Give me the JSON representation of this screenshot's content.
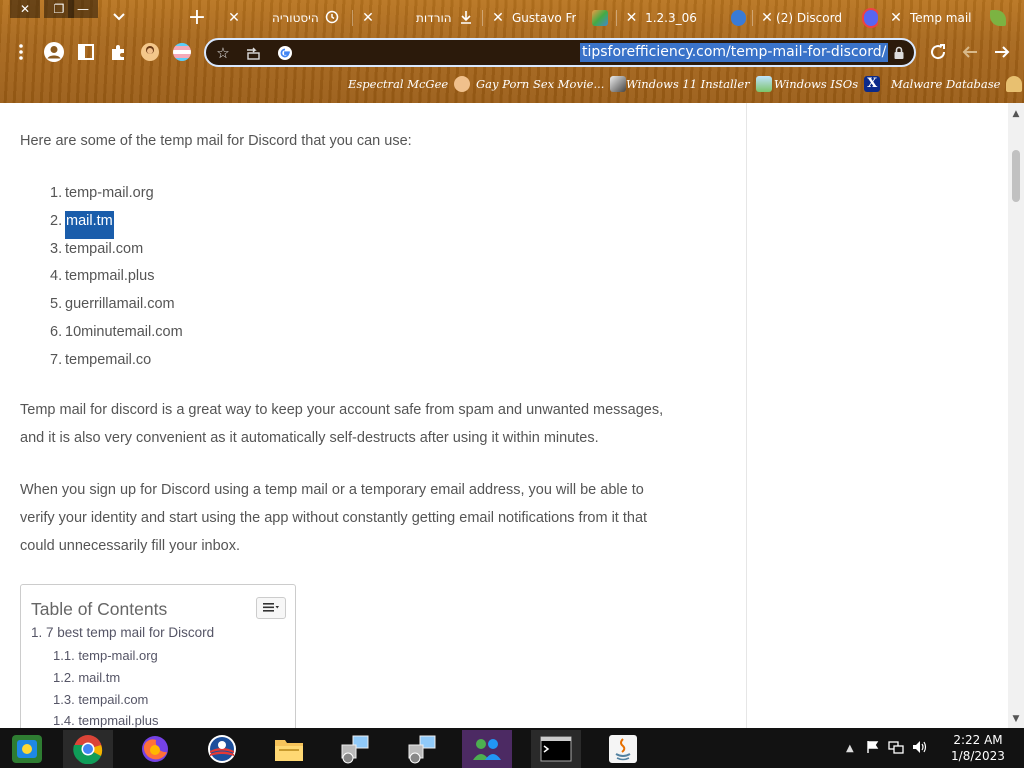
{
  "window_controls": {
    "close": "✕",
    "restore": "❐",
    "minimize": "—"
  },
  "tabs": [
    {
      "title": "",
      "icon": "chevron-down-icon"
    },
    {
      "title": "היסטוריה",
      "icon": "history-icon"
    },
    {
      "title": "הורדות",
      "icon": "download-icon"
    },
    {
      "title": "Gustavo Frin",
      "icon": "gustavo-favicon"
    },
    {
      "title": "1.2.3_06",
      "icon": "app-favicon"
    },
    {
      "title": "(2) Discord",
      "icon": "discord-icon"
    },
    {
      "title": "Temp mail fo",
      "icon": "leaf-favicon"
    }
  ],
  "new_tab_label": "+",
  "toolbar": {
    "url": "tipsforefficiency.com/temp-mail-for-discord/",
    "icons": [
      "menu-icon",
      "profile-icon",
      "sidebar-icon",
      "extensions-icon",
      "avatar-icon",
      "flag-icon",
      "star-icon",
      "share-icon",
      "google-icon",
      "lock-icon",
      "reload-icon",
      "back-icon",
      "forward-icon"
    ]
  },
  "bookmarks": [
    {
      "label": "Espectral McGee",
      "icon": "face-icon"
    },
    {
      "label": "Gay Porn Sex Movie...",
      "icon": "cube-icon"
    },
    {
      "label": "Windows 11 Installer",
      "icon": "photo-icon"
    },
    {
      "label": "Windows ISOs",
      "icon": "x-logo-icon"
    },
    {
      "label": "Malware Database",
      "icon": "malware-icon"
    }
  ],
  "article": {
    "intro": "Here are some of the temp mail for Discord that you can use:",
    "sites": [
      {
        "num": "1.",
        "label": "temp-mail.org",
        "selected": false
      },
      {
        "num": "2.",
        "label": "mail.tm",
        "selected": true
      },
      {
        "num": "3.",
        "label": "tempail.com",
        "selected": false
      },
      {
        "num": "4.",
        "label": "tempmail.plus",
        "selected": false
      },
      {
        "num": "5.",
        "label": "guerrillamail.com",
        "selected": false
      },
      {
        "num": "6.",
        "label": "10minutemail.com",
        "selected": false
      },
      {
        "num": "7.",
        "label": "tempemail.co",
        "selected": false
      }
    ],
    "para1": "Temp mail for discord is a great way to keep your account safe from spam and unwanted messages, and it is also very convenient as it automatically self-destructs after using it within minutes.",
    "para2": "When you sign up for Discord using a temp mail or a temporary email address, you will be able to verify your identity and start using the app without constantly getting email notifications from it that could unnecessarily fill your inbox."
  },
  "toc": {
    "title": "Table of Contents",
    "items": [
      {
        "num": "1.",
        "label": "7 best temp mail for Discord",
        "level": 1
      },
      {
        "num": "1.1.",
        "label": "temp-mail.org",
        "level": 2
      },
      {
        "num": "1.2.",
        "label": "mail.tm",
        "level": 2
      },
      {
        "num": "1.3.",
        "label": "tempail.com",
        "level": 2
      },
      {
        "num": "1.4.",
        "label": "tempmail.plus",
        "level": 2
      }
    ]
  },
  "taskbar": {
    "apps": [
      "windows-start-icon",
      "chrome-icon",
      "firefox-icon",
      "obama-icon",
      "file-explorer-icon",
      "network-app-icon",
      "network-app-icon-2",
      "users-icon",
      "cmd-icon",
      "java-icon"
    ],
    "time": "2:22 AM",
    "date": "1/8/2023"
  }
}
